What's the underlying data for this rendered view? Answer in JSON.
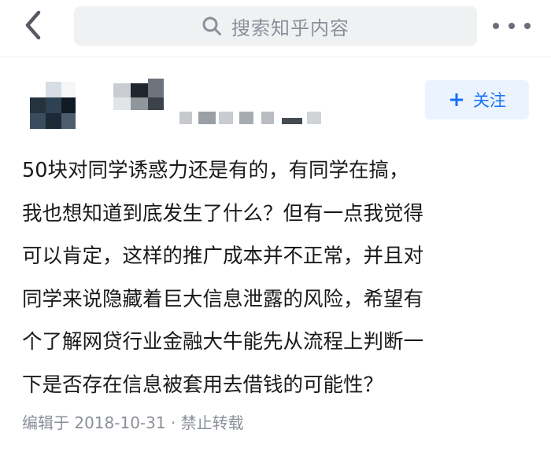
{
  "search": {
    "placeholder": "搜索知乎内容"
  },
  "author": {
    "follow_label": "关注"
  },
  "answer": {
    "lines": [
      "50块对同学诱惑力还是有的，有同学在搞，",
      "我也想知道到底发生了什么？但有一点我觉得",
      "可以肯定，这样的推广成本并不正常，并且对",
      "同学来说隐藏着巨大信息泄露的风险，希望有",
      "个了解网贷行业金融大牛能先从流程上判断一",
      "下是否存在信息被套用去借钱的可能性？"
    ],
    "meta": "编辑于 2018-10-31 · 禁止转载"
  },
  "colors": {
    "accent": "#1772f6",
    "follow_bg": "#ebf3ff",
    "search_bg": "#f0f1f3",
    "meta_text": "#8a8f99"
  },
  "icons": {
    "back": "chevron-left-icon",
    "search": "search-icon",
    "more": "more-dots-icon"
  }
}
